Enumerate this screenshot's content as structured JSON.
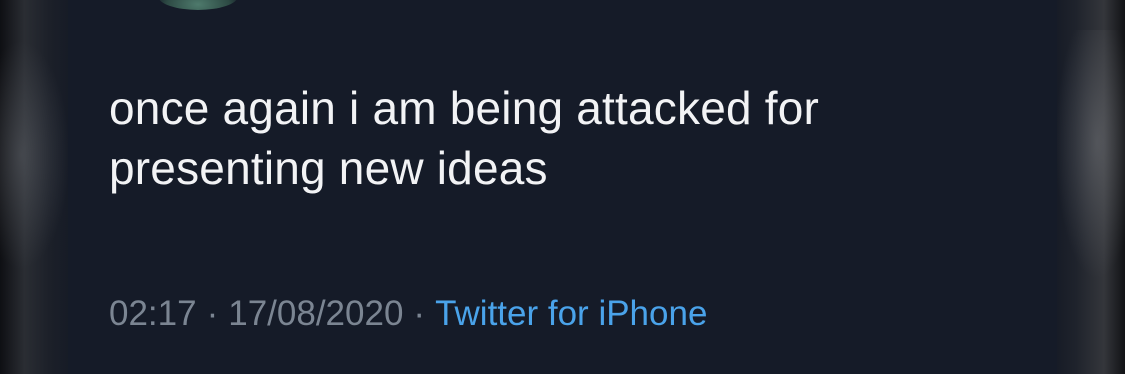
{
  "tweet": {
    "text_lines": [
      "once again i am being attacked for",
      "presenting new ideas"
    ],
    "time": "02:17",
    "separator": "·",
    "date": "17/08/2020",
    "source": "Twitter for iPhone"
  },
  "colors": {
    "background": "#151b28",
    "text": "#f2f3f5",
    "meta_text": "#7b8592",
    "link": "#4aa3ea"
  }
}
